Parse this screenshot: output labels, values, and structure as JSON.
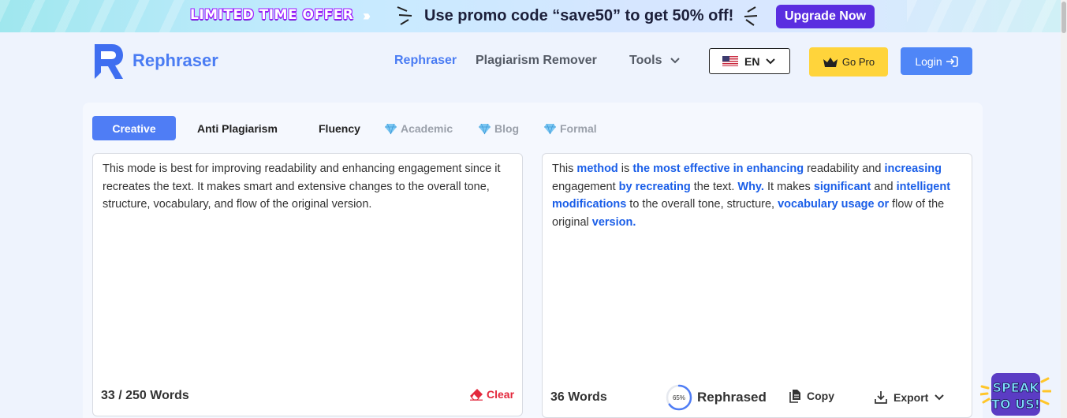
{
  "promo": {
    "offer_label": "LIMITED TIME OFFER",
    "message": "Use promo code “save50” to get 50% off!",
    "upgrade_label": "Upgrade Now"
  },
  "header": {
    "brand": "Rephraser",
    "nav": {
      "rephraser": "Rephraser",
      "plagiarism_remover": "Plagiarism Remover",
      "tools": "Tools"
    },
    "language": "EN",
    "go_pro": "Go Pro",
    "login": "Login"
  },
  "modes": {
    "creative": "Creative",
    "anti_plagiarism": "Anti Plagiarism",
    "fluency": "Fluency",
    "academic": "Academic",
    "blog": "Blog",
    "formal": "Formal"
  },
  "input": {
    "text": "This mode is best for improving readability and enhancing engagement since it recreates the text. It makes smart and extensive changes to the overall tone, structure, vocabulary, and flow of the original version.",
    "word_count": "33 / 250 Words",
    "clear_label": "Clear"
  },
  "output": {
    "segments": [
      {
        "t": " This ",
        "c": false
      },
      {
        "t": "method",
        "c": true
      },
      {
        "t": " is ",
        "c": false
      },
      {
        "t": "the most effective in enhancing",
        "c": true
      },
      {
        "t": " readability and ",
        "c": false
      },
      {
        "t": "increasing",
        "c": true
      },
      {
        "t": " engagement ",
        "c": false
      },
      {
        "t": "by recreating",
        "c": true
      },
      {
        "t": " the text.  ",
        "c": false
      },
      {
        "t": "Why.",
        "c": true
      },
      {
        "t": "  It makes ",
        "c": false
      },
      {
        "t": "significant",
        "c": true
      },
      {
        "t": " and ",
        "c": false
      },
      {
        "t": "intelligent modifications",
        "c": true
      },
      {
        "t": " to the overall tone, structure, ",
        "c": false
      },
      {
        "t": "vocabulary usage or",
        "c": true
      },
      {
        "t": " flow of the original ",
        "c": false
      },
      {
        "t": "version.",
        "c": true
      }
    ],
    "word_count": "36 Words",
    "progress_label": "65%",
    "progress_value": 0.65,
    "rephrased_label": "Rephrased",
    "copy_label": "Copy",
    "export_label": "Export"
  },
  "colors": {
    "accent": "#4f7df5",
    "changed_word": "#1a5ee8",
    "clear": "#e3283c",
    "go_pro": "#ffd43b",
    "promo_button": "#5a2ee0"
  },
  "icons": {
    "logo": "rephraser-logo-icon",
    "crown": "crown-icon",
    "login_arrow": "login-arrow-icon",
    "eraser": "eraser-icon",
    "copy": "copy-icon",
    "download": "download-icon",
    "gem": "diamond-icon"
  }
}
